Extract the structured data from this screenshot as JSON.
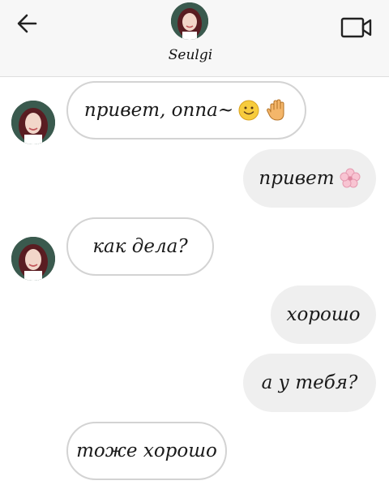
{
  "header": {
    "contact_name": "Seulgi",
    "back_icon": "arrow-left-icon",
    "video_icon": "video-camera-icon"
  },
  "messages": [
    {
      "direction": "incoming",
      "text": "привет, оппа~",
      "emoji": [
        "smiling-face-icon",
        "waving-hand-icon"
      ]
    },
    {
      "direction": "outgoing",
      "text": "привет",
      "emoji": [
        "cherry-blossom-icon"
      ]
    },
    {
      "direction": "incoming",
      "text": "как дела?"
    },
    {
      "direction": "outgoing",
      "text": "хорошо"
    },
    {
      "direction": "outgoing",
      "text": "а у тебя?"
    },
    {
      "direction": "incoming",
      "text": "тоже хорошо"
    }
  ],
  "colors": {
    "header_bg": "#f7f7f7",
    "incoming_bubble_border": "#d3d3d3",
    "outgoing_bubble_bg": "#efefef"
  }
}
